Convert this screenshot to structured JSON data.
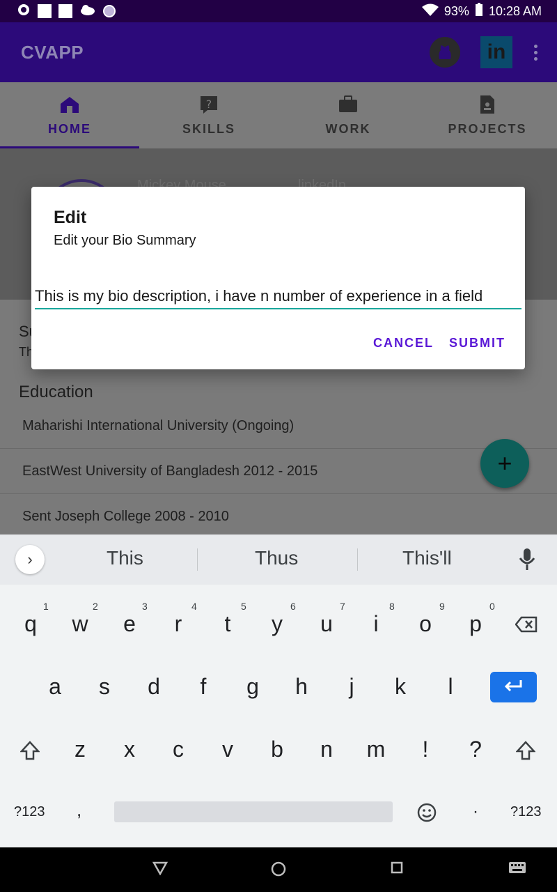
{
  "status_bar": {
    "battery": "93%",
    "time": "10:28 AM"
  },
  "app_bar": {
    "title": "CVAPP",
    "linkedin_label": "in"
  },
  "tabs": [
    {
      "label": "HOME",
      "active": true
    },
    {
      "label": "SKILLS",
      "active": false
    },
    {
      "label": "WORK",
      "active": false
    },
    {
      "label": "PROJECTS",
      "active": false
    }
  ],
  "profile": {
    "name": "Mickey Mouse",
    "linkedin": "linkedIn"
  },
  "summary": {
    "heading": "Su",
    "text": "Th"
  },
  "education": {
    "heading": "Education",
    "items": [
      "Maharishi International University (Ongoing)",
      "EastWest University of Bangladesh 2012 - 2015",
      "Sent Joseph College 2008 - 2010"
    ]
  },
  "fab": {
    "label": "+"
  },
  "dialog": {
    "title": "Edit",
    "subtitle": "Edit your Bio Summary",
    "input_value": "This is my bio description, i have n number of experience in a field",
    "cancel": "CANCEL",
    "submit": "SUBMIT"
  },
  "keyboard": {
    "suggestions": [
      "This",
      "Thus",
      "This'll"
    ],
    "row1": [
      "q",
      "w",
      "e",
      "r",
      "t",
      "y",
      "u",
      "i",
      "o",
      "p"
    ],
    "row1_hints": [
      "1",
      "2",
      "3",
      "4",
      "5",
      "6",
      "7",
      "8",
      "9",
      "0"
    ],
    "row2": [
      "a",
      "s",
      "d",
      "f",
      "g",
      "h",
      "j",
      "k",
      "l"
    ],
    "row3": [
      "z",
      "x",
      "c",
      "v",
      "b",
      "n",
      "m",
      "!",
      "?"
    ],
    "symbols_label": "?123",
    "comma": ",",
    "period": "·"
  },
  "colors": {
    "primary": "#2c0a7a",
    "accent": "#5a18d6",
    "input_underline": "#1aa79c",
    "fab": "#0d5f5a",
    "enter_key": "#1a73e8"
  }
}
